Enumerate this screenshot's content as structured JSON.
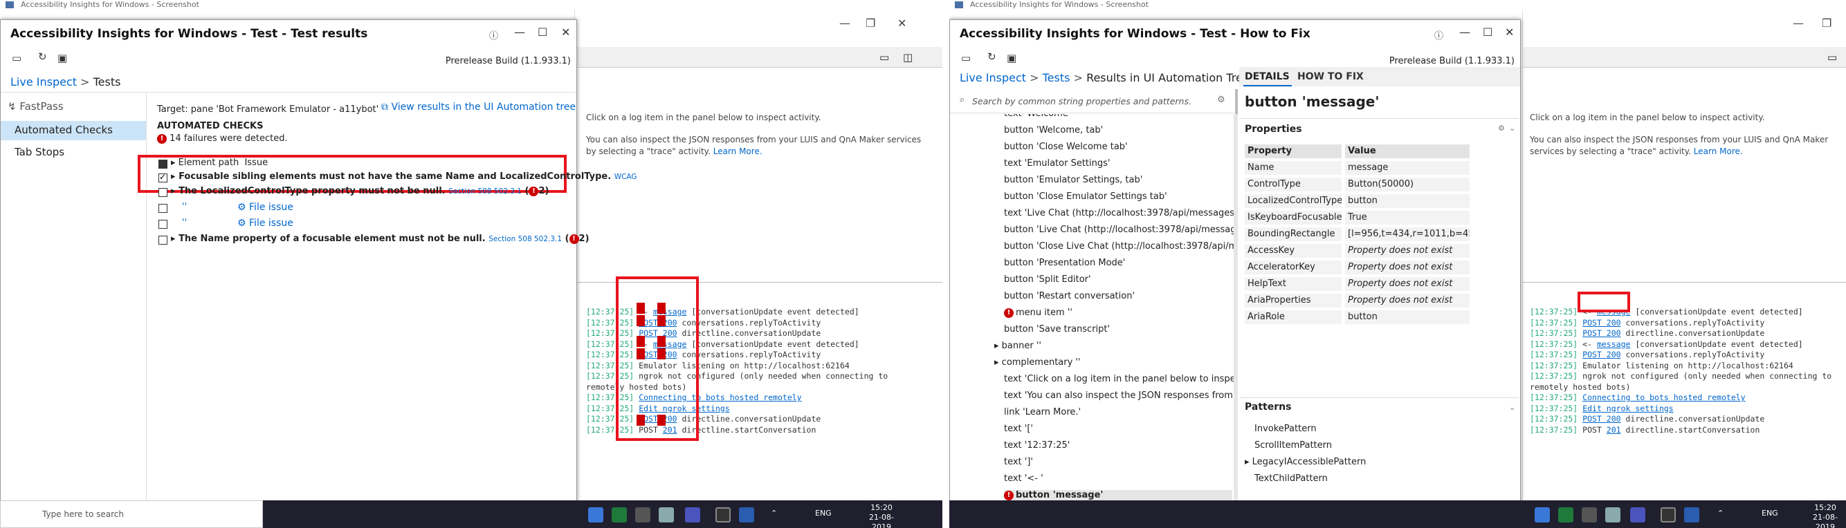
{
  "outer": {
    "left_title": "Accessibility Insights for Windows - Screenshot",
    "right_title": "Accessibility Insights for Windows - Screenshot"
  },
  "left_window": {
    "title": "Accessibility Insights for Windows - Test - Test results",
    "build": "Prerelease Build (1.1.933.1)",
    "breadcrumb": {
      "root": "Live Inspect",
      "sep": ">",
      "current": "Tests"
    },
    "nav": {
      "fastpass": "FastPass",
      "automated": "Automated Checks",
      "tabstops": "Tab Stops"
    },
    "target": "Target: pane 'Bot Framework Emulator - a11ybot'",
    "view_results_link": "View results in the UI Automation tree",
    "section_title": "AUTOMATED CHECKS",
    "failures": "14 failures were detected.",
    "header_row": {
      "col1": "Element path",
      "col2": "Issue"
    },
    "rows": [
      {
        "text": "Focusable sibling elements must not have the same Name and LocalizedControlType.",
        "tag": "WCAG"
      },
      {
        "text": "The LocalizedControlType property must not be null.",
        "section": "Section 508 502.3.1",
        "count": "2"
      },
      {
        "path": "''",
        "action": "File issue"
      },
      {
        "path": "''",
        "action": "File issue"
      },
      {
        "text": "The Name property of a focusable element must not be null.",
        "section": "Section 508 502.3.1",
        "count": "2"
      }
    ]
  },
  "bg_app": {
    "hint1": "Click on a log item in the panel below to inspect activity.",
    "hint2": "You can also inspect the JSON responses from your LUIS and QnA Maker services by selecting a \"trace\" activity.",
    "learn_more": "Learn More.",
    "log_left": [
      {
        "ts": "[12:37:25]",
        "text": " <- ",
        "link": "message",
        "rest": " [conversationUpdate event detected]"
      },
      {
        "ts": "[12:37:25]",
        "text": " ",
        "link": "POST 200",
        "rest": " conversations.replyToActivity"
      },
      {
        "ts": "[12:37:25]",
        "text": " ",
        "link": "POST 200",
        "rest": " directline.conversationUpdate"
      },
      {
        "ts": "[12:37:25]",
        "text": " <- ",
        "link": "message",
        "rest": " [conversationUpdate event detected]"
      },
      {
        "ts": "[12:37:25]",
        "text": " ",
        "link": "POST 200",
        "rest": " conversations.replyToActivity"
      },
      {
        "ts": "[12:37:25]",
        "text": " Emulator listening on http://localhost:62164",
        "link": "",
        "rest": ""
      },
      {
        "ts": "[12:37:25]",
        "text": " ngrok not configured (only needed when connecting to",
        "link": "",
        "rest": ""
      },
      {
        "ts": "",
        "text": "remotely hosted bots)",
        "link": "",
        "rest": ""
      },
      {
        "ts": "[12:37:25]",
        "text": " ",
        "link": "Connecting to bots hosted remotely",
        "rest": ""
      },
      {
        "ts": "[12:37:25]",
        "text": " ",
        "link": "Edit ngrok settings",
        "rest": ""
      },
      {
        "ts": "[12:37:25]",
        "text": " ",
        "link": "POST 200",
        "rest": " directline.conversationUpdate"
      },
      {
        "ts": "[12:37:25]",
        "text": " POST ",
        "link": "201",
        "rest": " directline.startConversation"
      }
    ]
  },
  "right_window": {
    "title": "Accessibility Insights for Windows - Test - How to Fix",
    "build": "Prerelease Build (1.1.933.1)",
    "breadcrumb": {
      "root": "Live Inspect",
      "sep": ">",
      "mid": "Tests",
      "current": "Results in UI Automation Tree"
    },
    "search_placeholder": "Search by common string properties and patterns.",
    "tree": [
      "text 'Welcome'",
      "button 'Welcome, tab'",
      "button 'Close Welcome tab'",
      "text 'Emulator Settings'",
      "button 'Emulator Settings, tab'",
      "button 'Close Emulator Settings tab'",
      "text 'Live Chat (http://localhost:3978/api/messages)'",
      "button 'Live Chat (http://localhost:3978/api/messag",
      "button 'Close Live Chat (http://localhost:3978/api/m",
      "button 'Presentation Mode'",
      "button 'Split Editor'",
      "button 'Restart conversation'",
      "menu item ''",
      "button 'Save transcript'",
      "banner ''",
      "complementary ''",
      "text 'Click on a log item in the panel below to inspe",
      "text 'You can also inspect the JSON responses from",
      "link 'Learn More.'",
      "text '['",
      "text '12:37:25'",
      "text ']'",
      "text '<- '",
      "button 'message'"
    ],
    "tabs": {
      "details": "DETAILS",
      "howto": "HOW TO FIX"
    },
    "element_title": "button 'message'",
    "properties_title": "Properties",
    "prop_headers": {
      "k": "Property",
      "v": "Value"
    },
    "properties": [
      {
        "k": "Name",
        "v": "message"
      },
      {
        "k": "ControlType",
        "v": "Button(50000)"
      },
      {
        "k": "LocalizedControlType",
        "v": "button"
      },
      {
        "k": "IsKeyboardFocusable",
        "v": "True"
      },
      {
        "k": "BoundingRectangle",
        "v": "[l=956,t=434,r=1011,b=451]"
      },
      {
        "k": "AccessKey",
        "v": "Property does not exist"
      },
      {
        "k": "AcceleratorKey",
        "v": "Property does not exist"
      },
      {
        "k": "HelpText",
        "v": "Property does not exist"
      },
      {
        "k": "AriaProperties",
        "v": "Property does not exist"
      },
      {
        "k": "AriaRole",
        "v": "button"
      }
    ],
    "patterns_title": "Patterns",
    "patterns": [
      "InvokePattern",
      "ScrollItemPattern",
      "LegacyIAccessiblePattern",
      "TextChildPattern"
    ]
  },
  "taskbar": {
    "search": "Type here to search",
    "lang": "ENG",
    "time": "15:20",
    "date": "21-08-2019"
  }
}
